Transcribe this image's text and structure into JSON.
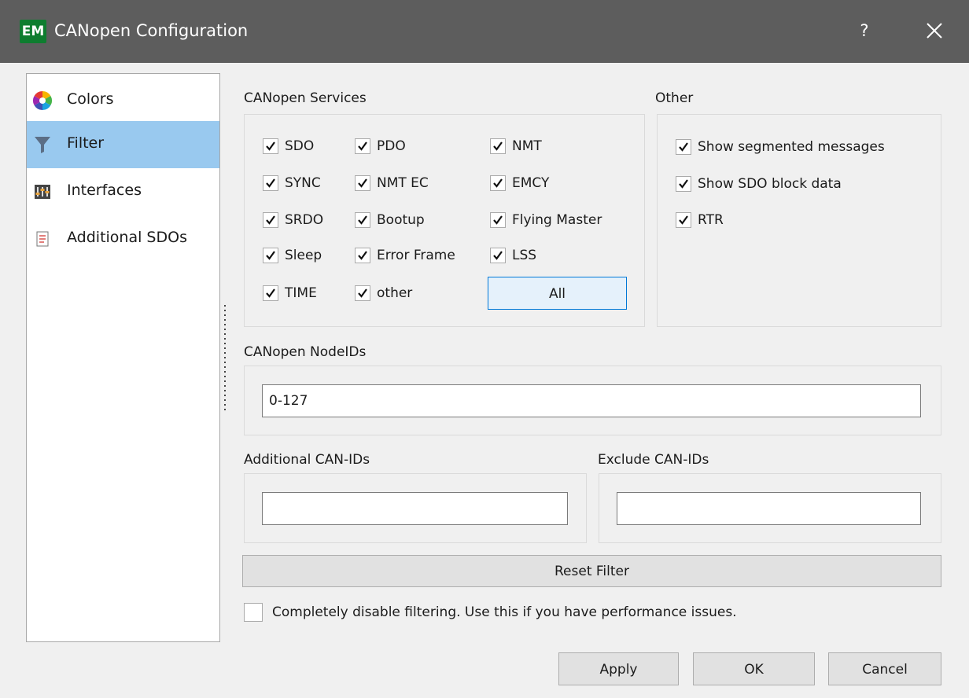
{
  "window": {
    "logo_text": "EM",
    "title": "CANopen Configuration",
    "help_label": "?"
  },
  "nav": {
    "items": [
      {
        "label": "Colors",
        "icon": "color-wheel-icon"
      },
      {
        "label": "Filter",
        "icon": "funnel-icon",
        "selected": true
      },
      {
        "label": "Interfaces",
        "icon": "sliders-icon"
      },
      {
        "label": "Additional SDOs",
        "icon": "document-icon"
      }
    ]
  },
  "services": {
    "title": "CANopen Services",
    "checkboxes": [
      {
        "label": "SDO",
        "checked": true
      },
      {
        "label": "PDO",
        "checked": true
      },
      {
        "label": "NMT",
        "checked": true
      },
      {
        "label": "SYNC",
        "checked": true
      },
      {
        "label": "NMT EC",
        "checked": true
      },
      {
        "label": "EMCY",
        "checked": true
      },
      {
        "label": "SRDO",
        "checked": true
      },
      {
        "label": "Bootup",
        "checked": true
      },
      {
        "label": "Flying Master",
        "checked": true
      },
      {
        "label": "Sleep",
        "checked": true
      },
      {
        "label": "Error Frame",
        "checked": true
      },
      {
        "label": "LSS",
        "checked": true
      },
      {
        "label": "TIME",
        "checked": true
      },
      {
        "label": "other",
        "checked": true
      }
    ],
    "all_button": "All"
  },
  "other": {
    "title": "Other",
    "checkboxes": [
      {
        "label": "Show segmented messages",
        "checked": true
      },
      {
        "label": "Show SDO block data",
        "checked": true
      },
      {
        "label": "RTR",
        "checked": true
      }
    ]
  },
  "node_ids": {
    "title": "CANopen NodeIDs",
    "value": "0-127"
  },
  "additional_ids": {
    "title": "Additional CAN-IDs",
    "value": ""
  },
  "exclude_ids": {
    "title": "Exclude CAN-IDs",
    "value": ""
  },
  "reset_button": "Reset Filter",
  "disable_filtering": {
    "label": "Completely disable filtering. Use this if you have performance issues.",
    "checked": false
  },
  "footer": {
    "apply": "Apply",
    "ok": "OK",
    "cancel": "Cancel"
  }
}
